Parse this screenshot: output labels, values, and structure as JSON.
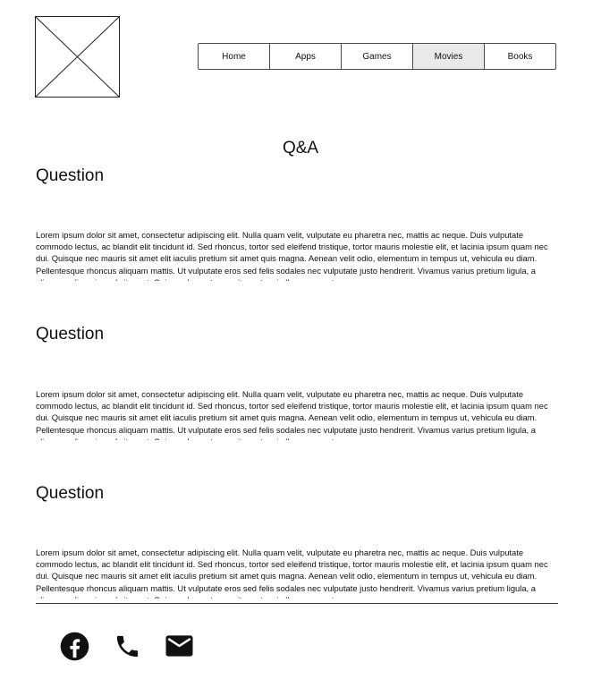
{
  "nav": {
    "items": [
      {
        "label": "Home"
      },
      {
        "label": "Apps"
      },
      {
        "label": "Games"
      },
      {
        "label": "Movies"
      },
      {
        "label": "Books"
      }
    ],
    "active": "Movies"
  },
  "page": {
    "title": "Q&A"
  },
  "questions": [
    {
      "heading": "Question",
      "answer": "Lorem ipsum dolor sit amet, consectetur adipiscing elit. Nulla quam velit, vulputate eu pharetra nec, mattis ac neque. Duis vulputate commodo lectus, ac blandit elit tincidunt id. Sed rhoncus, tortor sed eleifend tristique, tortor mauris molestie elit, et lacinia ipsum quam nec dui. Quisque nec mauris sit amet elit iaculis pretium sit amet quis magna. Aenean velit odio, elementum in tempus ut, vehicula eu diam. Pellentesque rhoncus aliquam mattis. Ut vulputate eros sed felis sodales nec vulputate justo hendrerit. Vivamus varius pretium ligula, a aliquam odio euismod sit amet. Quisque laoreet sem sit amet orci ullamcorper at"
    },
    {
      "heading": "Question",
      "answer": "Lorem ipsum dolor sit amet, consectetur adipiscing elit. Nulla quam velit, vulputate eu pharetra nec, mattis ac neque. Duis vulputate commodo lectus, ac blandit elit tincidunt id. Sed rhoncus, tortor sed eleifend tristique, tortor mauris molestie elit, et lacinia ipsum quam nec dui. Quisque nec mauris sit amet elit iaculis pretium sit amet quis magna. Aenean velit odio, elementum in tempus ut, vehicula eu diam. Pellentesque rhoncus aliquam mattis. Ut vulputate eros sed felis sodales nec vulputate justo hendrerit. Vivamus varius pretium ligula, a aliquam odio euismod sit amet. Quisque laoreet sem sit amet orci ullamcorper at"
    },
    {
      "heading": "Question",
      "answer": "Lorem ipsum dolor sit amet, consectetur adipiscing elit. Nulla quam velit, vulputate eu pharetra nec, mattis ac neque. Duis vulputate commodo lectus, ac blandit elit tincidunt id. Sed rhoncus, tortor sed eleifend tristique, tortor mauris molestie elit, et lacinia ipsum quam nec dui. Quisque nec mauris sit amet elit iaculis pretium sit amet quis magna. Aenean velit odio, elementum in tempus ut, vehicula eu diam. Pellentesque rhoncus aliquam mattis. Ut vulputate eros sed felis sodales nec vulputate justo hendrerit. Vivamus varius pretium ligula, a aliquam odio euismod sit amet. Quisque laoreet sem sit amet orci ullamcorper at"
    }
  ],
  "footer": {
    "icons": [
      "facebook-icon",
      "phone-icon",
      "mail-icon"
    ]
  }
}
